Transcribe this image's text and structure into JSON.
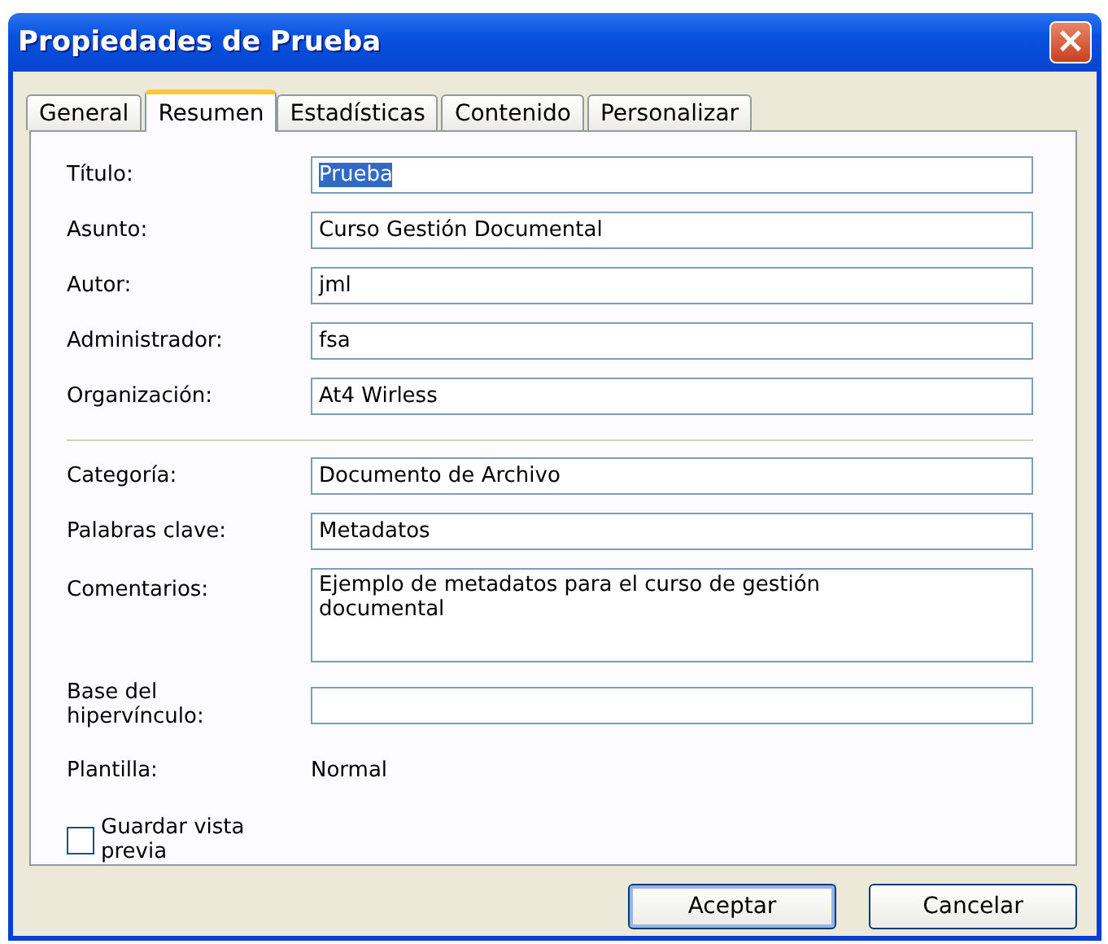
{
  "window": {
    "title": "Propiedades de Prueba",
    "close": "×"
  },
  "tabs": [
    {
      "label": "General",
      "selected": false
    },
    {
      "label": "Resumen",
      "selected": true
    },
    {
      "label": "Estadísticas",
      "selected": false
    },
    {
      "label": "Contenido",
      "selected": false
    },
    {
      "label": "Personalizar",
      "selected": false
    }
  ],
  "sections": [
    {
      "fields": [
        {
          "kind": "field",
          "label": "Título:",
          "value": "Prueba",
          "text_selected": true
        },
        {
          "kind": "field",
          "label": "Asunto:",
          "value": "Curso Gestión Documental",
          "text_selected": false
        },
        {
          "kind": "field",
          "label": "Autor:",
          "value": "jml",
          "text_selected": false
        },
        {
          "kind": "field",
          "label": "Administrador:",
          "value": "fsa",
          "text_selected": false
        },
        {
          "kind": "field",
          "label": "Organización:",
          "value": "At4 Wirless",
          "text_selected": false
        }
      ]
    },
    {
      "fields": [
        {
          "kind": "field",
          "label": "Categoría:",
          "value": "Documento de Archivo",
          "text_selected": false
        },
        {
          "kind": "field",
          "label": "Palabras clave:",
          "value": "Metadatos",
          "text_selected": false
        },
        {
          "kind": "textarea",
          "label": "Comentarios:",
          "value": "Ejemplo de metadatos para el curso de gestión documental",
          "text_selected": false
        },
        {
          "kind": "field",
          "label": "Base del hipervínculo:"
        },
        {
          "kind": "static",
          "label": "Plantilla:",
          "value": "Normal"
        }
      ]
    }
  ],
  "checkbox": {
    "label": "Guardar vista previa",
    "checked": false
  },
  "buttons": [
    {
      "label": "Aceptar",
      "default": true
    },
    {
      "label": "Cancelar",
      "default": false
    }
  ]
}
